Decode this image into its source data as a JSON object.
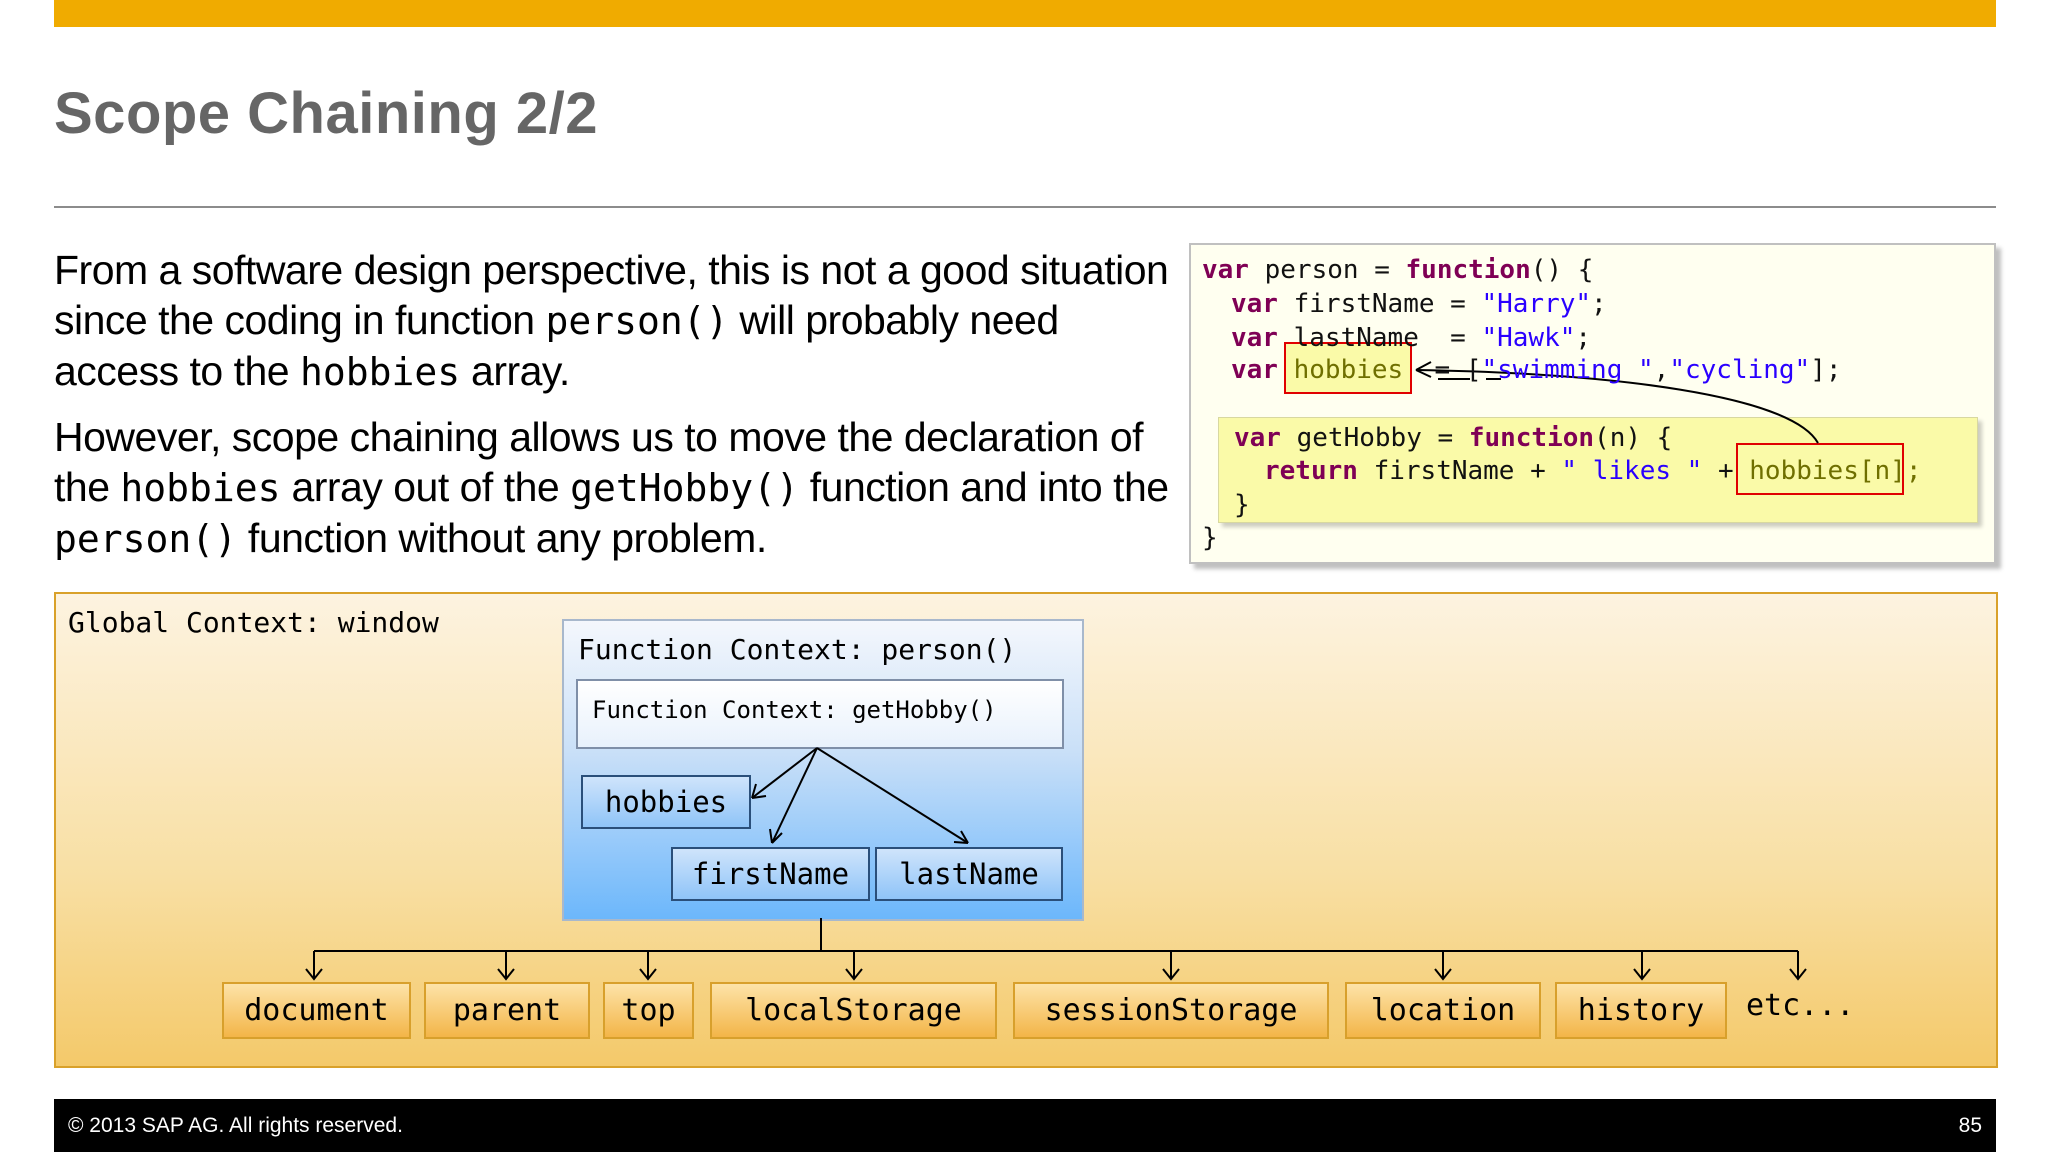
{
  "slide": {
    "title": "Scope Chaining 2/2",
    "page_number": "85",
    "copyright": "© 2013 SAP AG. All rights reserved."
  },
  "body": {
    "p1_a": "From a software design perspective, this is not a good situation since the coding in function ",
    "p1_code1": "person()",
    "p1_b": " will probably need access to the ",
    "p1_code2": "hobbies",
    "p1_c": " array.",
    "p2_a": "However, scope chaining allows us to move the declaration of the ",
    "p2_code1": "hobbies",
    "p2_b": " array out of the ",
    "p2_code2": "getHobby()",
    "p2_c": " function and into the ",
    "p2_code3": "person()",
    "p2_d": " function without any problem."
  },
  "code": {
    "l1_kw": "var",
    "l1_a": " person = ",
    "l1_kw2": "function",
    "l1_b": "() {",
    "l2_kw": "var",
    "l2_a": " firstName = ",
    "l2_str": "\"Harry\"",
    "l2_b": ";",
    "l3_kw": "var",
    "l3_a": " lastName  = ",
    "l3_str": "\"Hawk\"",
    "l3_b": ";",
    "l4_kw": "var",
    "l4_hl": "hobbies",
    "l4_a": "  = [",
    "l4_str1": "\"swimming \"",
    "l4_b": ",",
    "l4_str2": "\"cycling\"",
    "l4_c": "];",
    "l5_kw": "var",
    "l5_a": " getHobby = ",
    "l5_kw2": "function",
    "l5_b": "(n) {",
    "l6_kw": "return",
    "l6_a": " firstName + ",
    "l6_str": "\" likes \"",
    "l6_b": " + ",
    "l6_hl": "hobbies[n];",
    "l7": "}",
    "l8": "}"
  },
  "diagram": {
    "global_label": "Global Context: window",
    "function_label": "Function Context: person()",
    "inner_function_label": "Function Context: getHobby()",
    "vars": [
      "hobbies",
      "firstName",
      "lastName"
    ],
    "window_objects": [
      "document",
      "parent",
      "top",
      "localStorage",
      "sessionStorage",
      "location",
      "history"
    ],
    "etc": "etc..."
  }
}
